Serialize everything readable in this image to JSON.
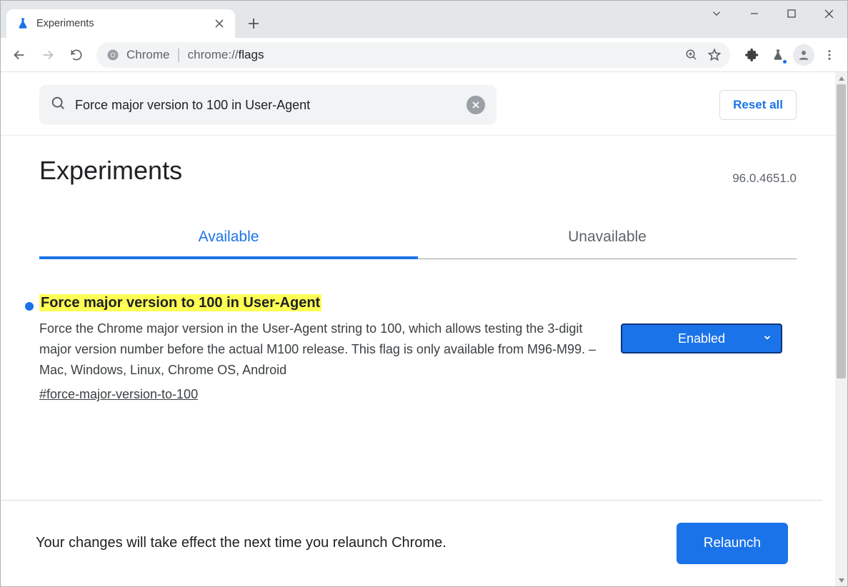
{
  "window": {
    "tab_title": "Experiments"
  },
  "toolbar": {
    "url_label": "Chrome",
    "url_scheme": "chrome://",
    "url_path": "flags"
  },
  "search": {
    "value": "Force major version to 100 in User-Agent",
    "reset_label": "Reset all"
  },
  "page": {
    "title": "Experiments",
    "version": "96.0.4651.0"
  },
  "tabs": {
    "available": "Available",
    "unavailable": "Unavailable"
  },
  "flag": {
    "title": "Force major version to 100 in User-Agent",
    "description": "Force the Chrome major version in the User-Agent string to 100, which allows testing the 3-digit major version number before the actual M100 release. This flag is only available from M96-M99. – Mac, Windows, Linux, Chrome OS, Android",
    "anchor": "#force-major-version-to-100",
    "select_value": "Enabled"
  },
  "bottom": {
    "message": "Your changes will take effect the next time you relaunch Chrome.",
    "button": "Relaunch"
  }
}
